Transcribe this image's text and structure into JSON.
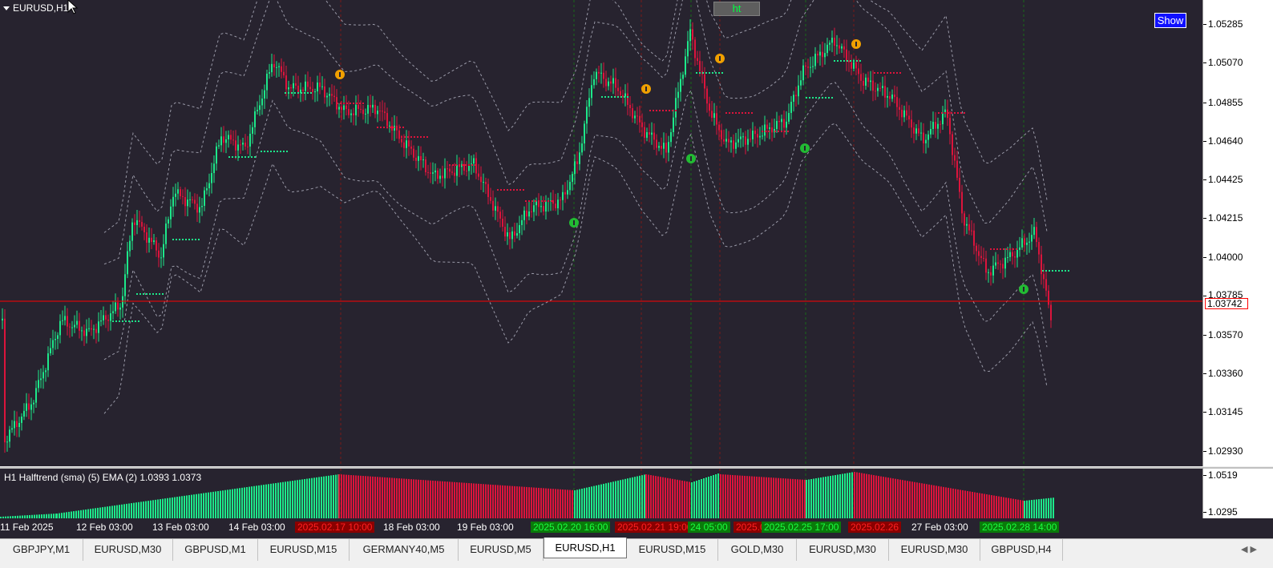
{
  "window": {
    "symbol_title": "EURUSD,H1"
  },
  "buttons": {
    "show": "Show",
    "ht": "ht"
  },
  "price_scale": {
    "labels": [
      "1.05285",
      "1.05070",
      "1.04855",
      "1.04640",
      "1.04425",
      "1.04215",
      "1.04000",
      "1.03785",
      "1.03570",
      "1.03360",
      "1.03145",
      "1.02930"
    ],
    "current_price": "1.03742"
  },
  "indicator": {
    "title": "H1 Halftrend (sma) (5) EMA (2) 1.0393 1.0373",
    "scale_labels": [
      "1.0519",
      "1.0295"
    ]
  },
  "time_axis": {
    "labels": [
      "11 Feb 2025",
      "12 Feb 03:00",
      "13 Feb 03:00",
      "14 Feb 03:00",
      "18 Feb 03:00",
      "19 Feb 03:00",
      "27 Feb 03:00"
    ],
    "highlight_labels": [
      {
        "text": "2025.02.17 10:00",
        "style": "red"
      },
      {
        "text": "2025.02.20 16:00",
        "style": "green"
      },
      {
        "text": "2025.02.21 19:00",
        "style": "red"
      },
      {
        "text": "24 05:00",
        "style": "green"
      },
      {
        "text": "2025.02",
        "style": "red"
      },
      {
        "text": "2025.02.25 17:00",
        "style": "green"
      },
      {
        "text": "2025.02.26",
        "style": "red"
      },
      {
        "text": "2025.02.28 14:00",
        "style": "green"
      }
    ]
  },
  "tabs": [
    {
      "label": "GBPJPY,M1",
      "active": false
    },
    {
      "label": "EURUSD,M30",
      "active": false
    },
    {
      "label": "GBPUSD,M1",
      "active": false
    },
    {
      "label": "EURUSD,M15",
      "active": false
    },
    {
      "label": "GERMANY40,M5",
      "active": false
    },
    {
      "label": "EURUSD,M5",
      "active": false
    },
    {
      "label": "EURUSD,H1",
      "active": true
    },
    {
      "label": "EURUSD,M15",
      "active": false
    },
    {
      "label": "GOLD,M30",
      "active": false
    },
    {
      "label": "EURUSD,M30",
      "active": false
    },
    {
      "label": "EURUSD,M30",
      "active": false
    },
    {
      "label": "GBPUSD,H4",
      "active": false
    }
  ],
  "colors": {
    "background": "#27232f",
    "bull": "#1de88a",
    "bear": "#dc143c",
    "price_line": "#ff0000",
    "signal_up": "#22bb33",
    "signal_down": "#f0a000"
  },
  "icons": {
    "tab_scroll": "tab-scroll-arrows-icon",
    "cursor": "mouse-cursor-icon"
  }
}
